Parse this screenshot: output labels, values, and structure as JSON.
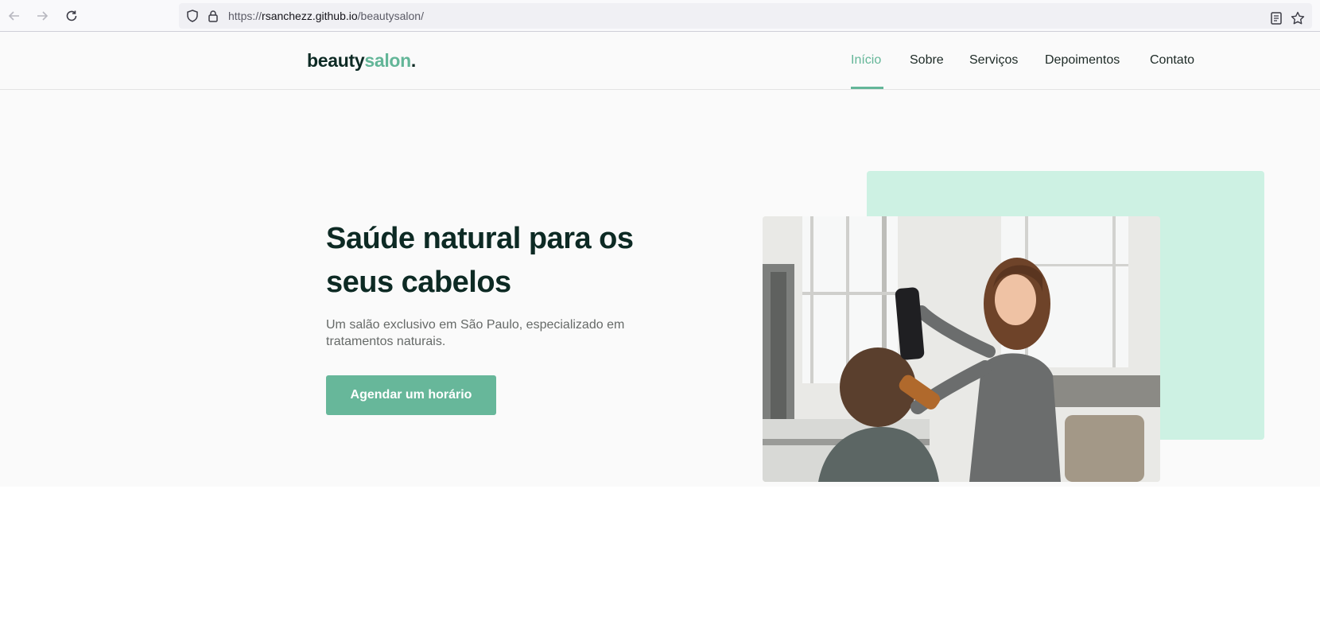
{
  "browser": {
    "url_prefix": "https://",
    "url_host": "rsanchezz.github.io",
    "url_path": "/beautysalon/"
  },
  "site": {
    "logo_main": "beauty",
    "logo_accent": "salon",
    "logo_dot": ".",
    "menu": [
      {
        "label": "Início",
        "active": true
      },
      {
        "label": "Sobre",
        "active": false
      },
      {
        "label": "Serviços",
        "active": false
      },
      {
        "label": "Depoimentos",
        "active": false
      },
      {
        "label": "Contato",
        "active": false
      }
    ],
    "accent_color": "#63b698"
  },
  "hero": {
    "title": "Saúde natural para os seus cabelos",
    "subtitle": "Um salão exclusivo em São Paulo, especializado em tratamentos naturais.",
    "cta_label": "Agendar um horário",
    "image_alt": "hairdresser-styling-client-photo"
  }
}
